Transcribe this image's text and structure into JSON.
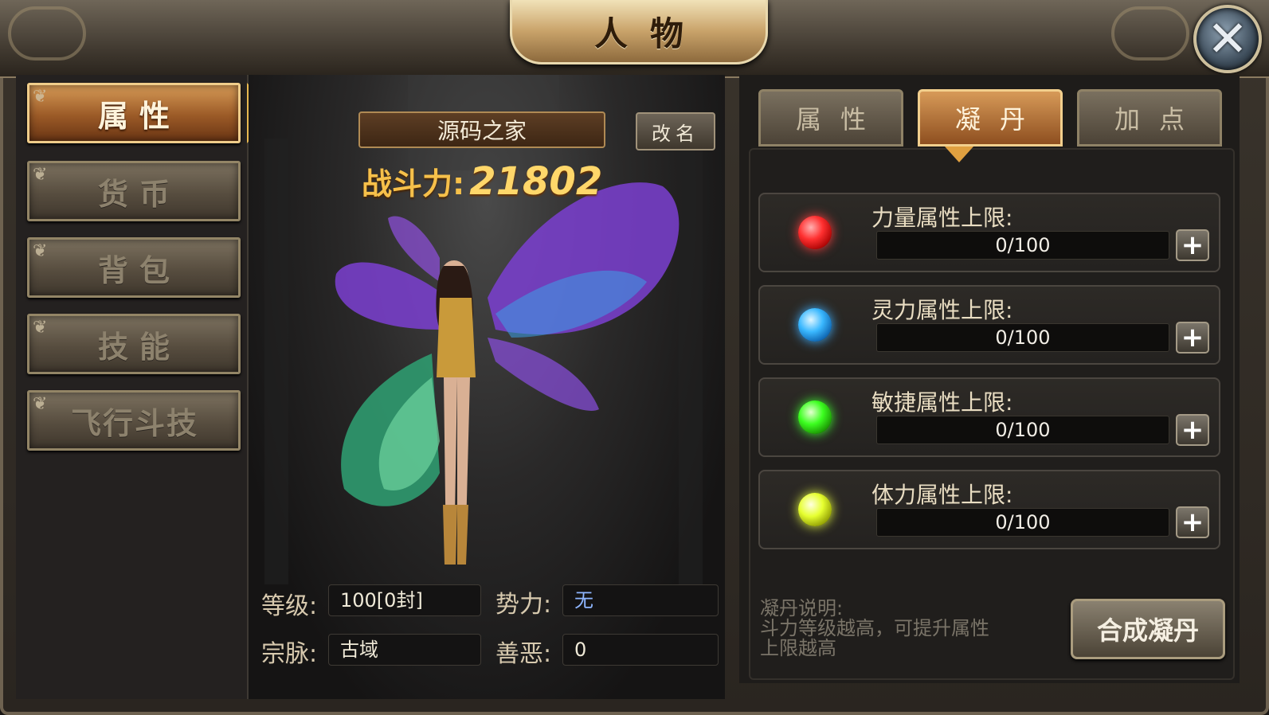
{
  "window": {
    "title": "人物",
    "close_icon": "close-x-icon"
  },
  "left_nav": {
    "items": [
      {
        "label": "属性",
        "active": true
      },
      {
        "label": "货币",
        "active": false
      },
      {
        "label": "背包",
        "active": false
      },
      {
        "label": "技能",
        "active": false
      },
      {
        "label": "飞行斗技",
        "active": false
      }
    ]
  },
  "character": {
    "name": "源码之家",
    "rename_label": "改名",
    "power_label": "战斗力",
    "power_value": "21802",
    "info": {
      "level_label": "等级:",
      "level_value": "100[0封]",
      "faction_label": "势力:",
      "faction_value": "无",
      "lineage_label": "宗脉:",
      "lineage_value": "古域",
      "karma_label": "善恶:",
      "karma_value": "0"
    }
  },
  "right_panel": {
    "tabs": [
      {
        "label": "属性",
        "active": false
      },
      {
        "label": "凝丹",
        "active": true
      },
      {
        "label": "加点",
        "active": false
      }
    ],
    "attributes": [
      {
        "label": "力量属性上限:",
        "value": "0/100",
        "progress": 0,
        "orb": "red-orb-icon",
        "color": "#ff3030"
      },
      {
        "label": "灵力属性上限:",
        "value": "0/100",
        "progress": 0,
        "orb": "blue-orb-icon",
        "color": "#3ab8ff"
      },
      {
        "label": "敏捷属性上限:",
        "value": "0/100",
        "progress": 0,
        "orb": "green-orb-icon",
        "color": "#3cff20"
      },
      {
        "label": "体力属性上限:",
        "value": "0/100",
        "progress": 0,
        "orb": "yellow-orb-icon",
        "color": "#e6ff30"
      }
    ],
    "plus_icon": "plus-icon",
    "description": {
      "title": "凝丹说明:",
      "line1": "斗力等级越高，可提升属性",
      "line2": "上限越高"
    },
    "combine_label": "合成凝丹"
  }
}
